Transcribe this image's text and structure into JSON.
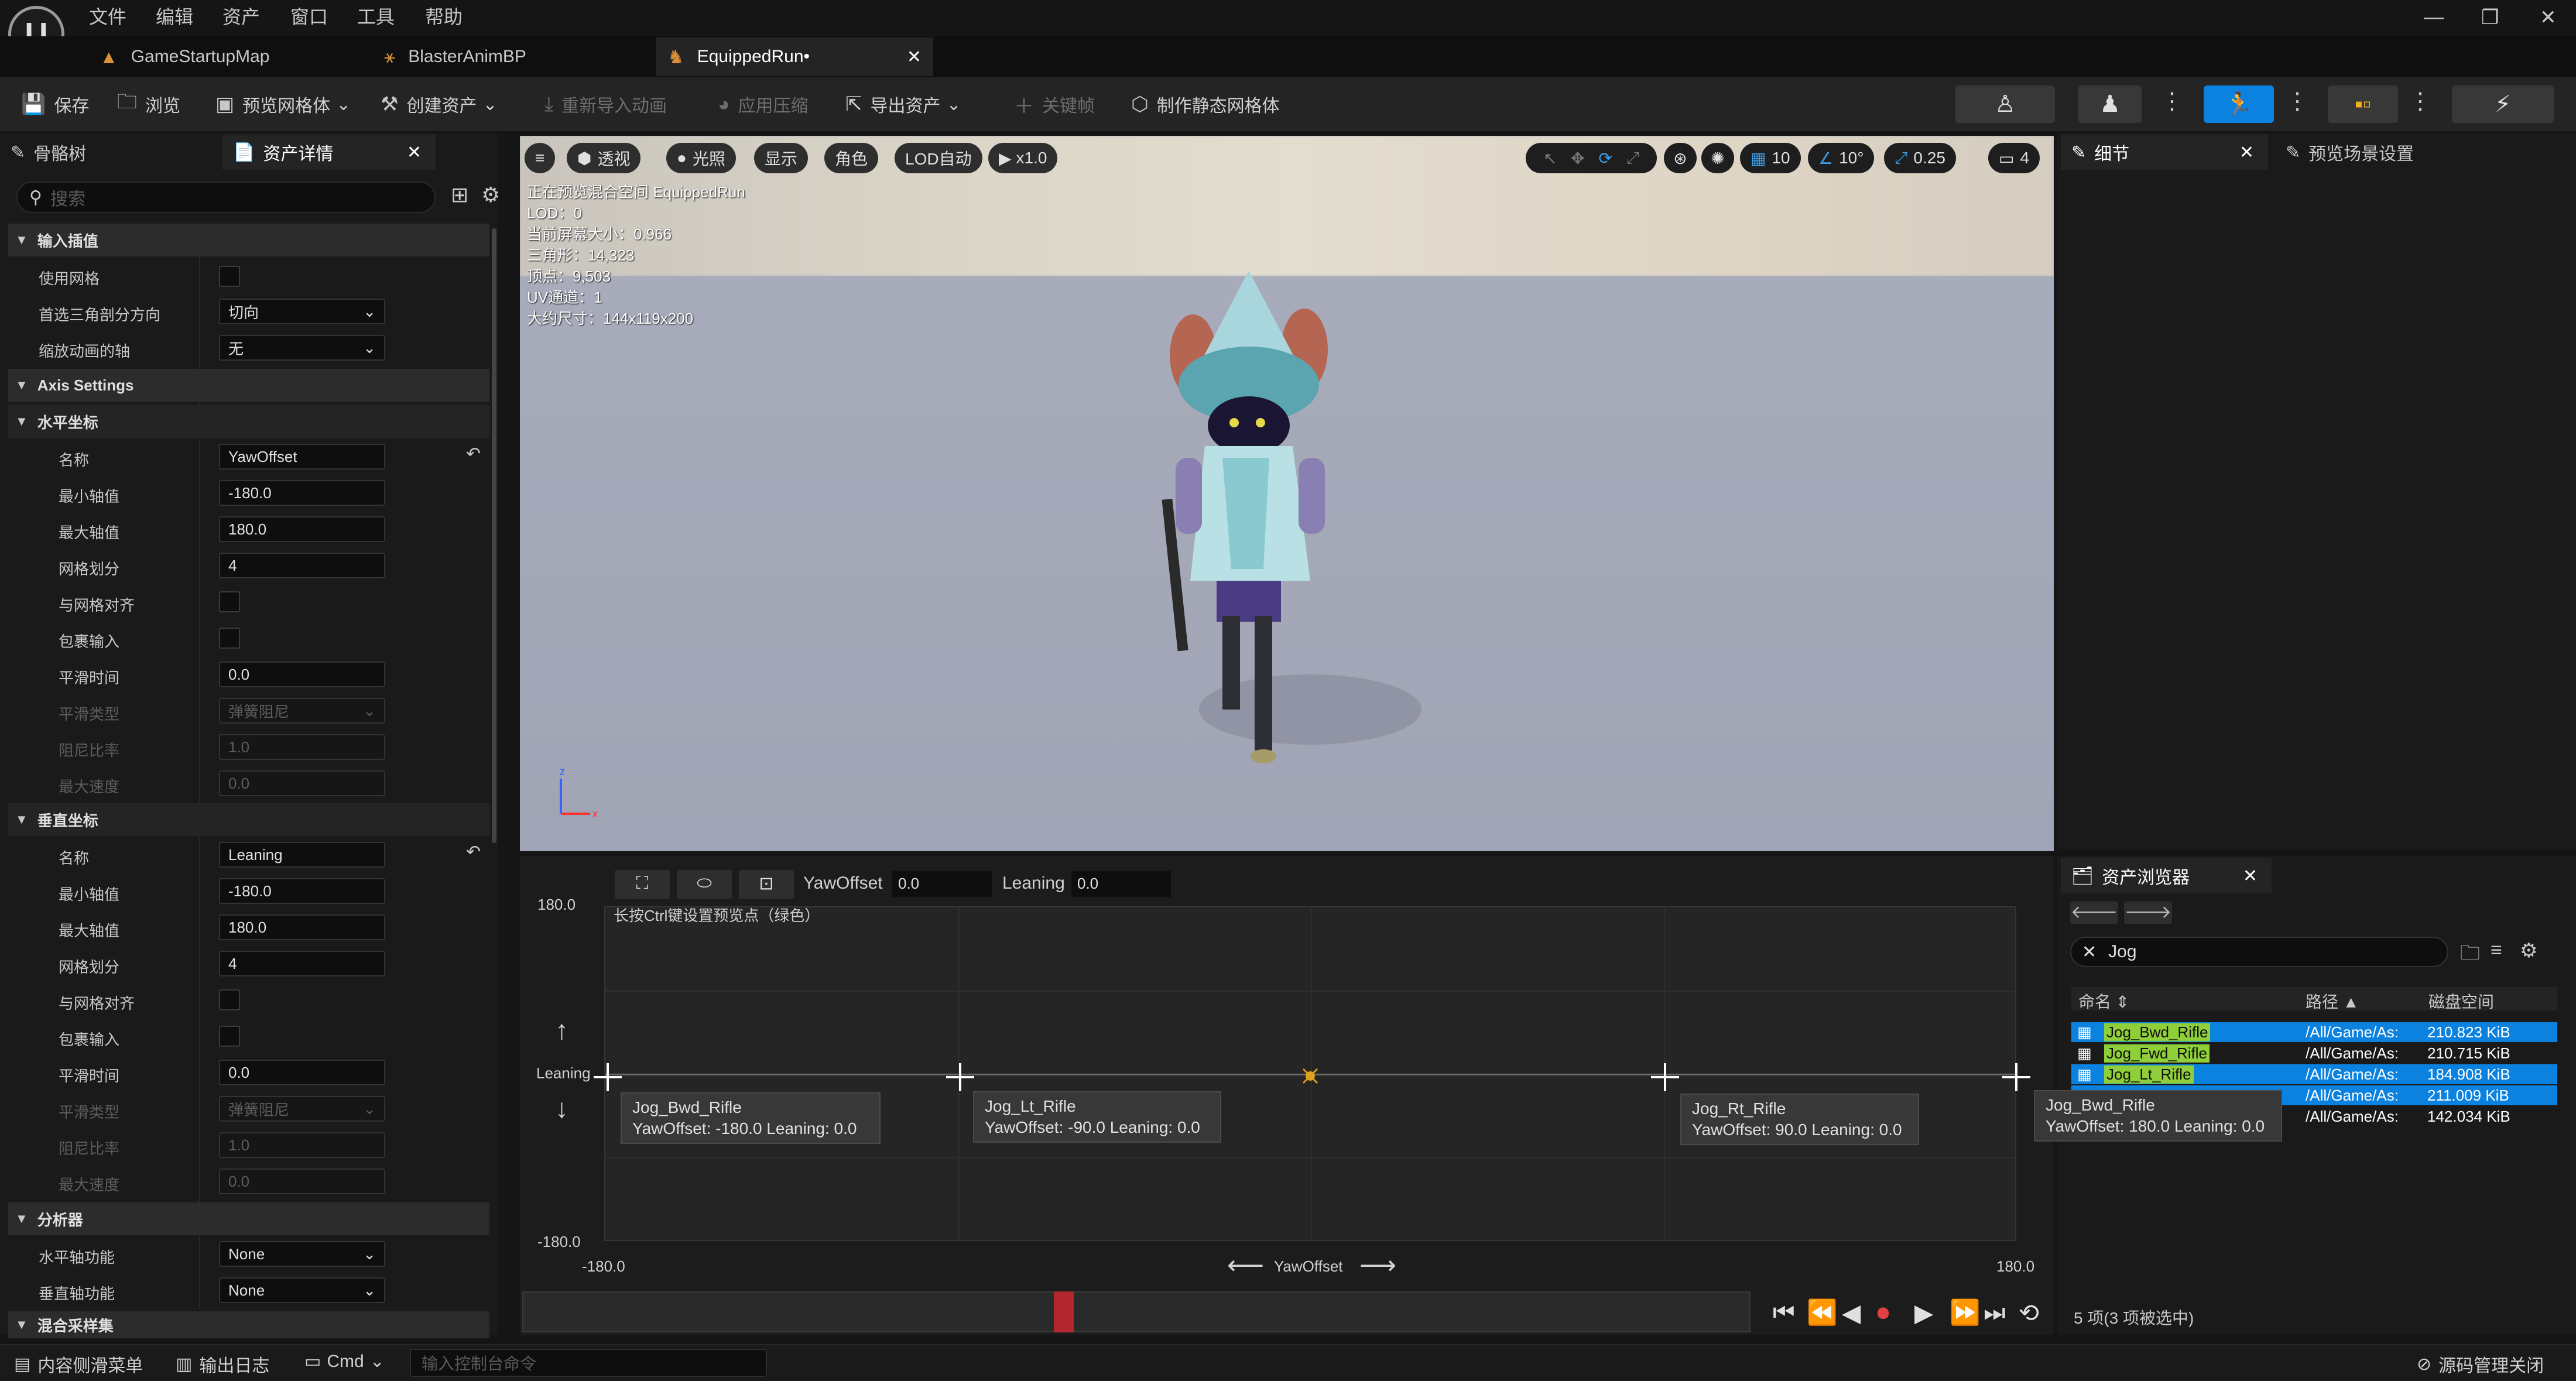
{
  "menu": [
    "文件",
    "编辑",
    "资产",
    "窗口",
    "工具",
    "帮助"
  ],
  "tabs": [
    {
      "label": "GameStartupMap",
      "icon": "level-icon"
    },
    {
      "label": "BlasterAnimBP",
      "icon": "anim-blueprint-icon"
    },
    {
      "label": "EquippedRun•",
      "icon": "blendspace-icon",
      "active": true
    }
  ],
  "toolbar": {
    "save": "保存",
    "browse": "浏览",
    "preview_mesh": "预览网格体",
    "create_asset": "创建资产",
    "reimport": "重新导入动画",
    "apply_compression": "应用压缩",
    "export_asset": "导出资产",
    "keyframe": "关键帧",
    "make_static_mesh": "制作静态网格体"
  },
  "left_panel": {
    "tab_skeleton": "骨骼树",
    "tab_asset_details": "资产详情",
    "search_placeholder": "搜索",
    "sections": {
      "input_interp": "输入插值",
      "axis_settings": "Axis Settings",
      "horizontal": "水平坐标",
      "vertical": "垂直坐标",
      "analysis": "分析器",
      "blend_samples": "混合采样集"
    },
    "labels": {
      "use_mesh": "使用网格",
      "preferred_tri_dir": "首选三角剖分方向",
      "scale_anim_axis": "缩放动画的轴",
      "name": "名称",
      "min": "最小轴值",
      "max": "最大轴值",
      "grid_divisions": "网格划分",
      "snap_grid": "与网格对齐",
      "wrap_input": "包裹输入",
      "smooth_time": "平滑时间",
      "smooth_type": "平滑类型",
      "damping_ratio": "阻尼比率",
      "max_speed": "最大速度",
      "h_func": "水平轴功能",
      "v_func": "垂直轴功能"
    },
    "values": {
      "preferred_tri_dir": "切向",
      "scale_anim_axis": "无",
      "h_name": "YawOffset",
      "h_min": "-180.0",
      "h_max": "180.0",
      "h_grid": "4",
      "h_smooth": "0.0",
      "h_smooth_type": "弹簧阻尼",
      "h_damping": "1.0",
      "h_maxspeed": "0.0",
      "v_name": "Leaning",
      "v_min": "-180.0",
      "v_max": "180.0",
      "v_grid": "4",
      "v_smooth": "0.0",
      "v_smooth_type": "弹簧阻尼",
      "v_damping": "1.0",
      "v_maxspeed": "0.0",
      "h_func": "None",
      "v_func": "None"
    }
  },
  "viewport": {
    "menu": "≡",
    "perspective": "透视",
    "lit": "光照",
    "show": "显示",
    "character": "角色",
    "lod": "LOD自动",
    "speed": "x1.0",
    "grid_snap": "10",
    "rot_snap": "10°",
    "scale_snap": "0.25",
    "cam_speed": "4",
    "stats": [
      "正在预览混合空间 EquippedRun",
      "LOD：0",
      "当前屏幕大小：0.966",
      "三角形：14,323",
      "顶点：9,503",
      "UV通道：1",
      "大约尺寸：144x119x200"
    ]
  },
  "right_panel": {
    "tab_details": "细节",
    "tab_preview_settings": "预览场景设置"
  },
  "asset_browser": {
    "title": "资产浏览器",
    "search_value": "Jog",
    "columns": [
      "命名",
      "路径",
      "磁盘空间"
    ],
    "rows": [
      {
        "name": "Jog_Bwd_Rifle",
        "path": "/All/Game/As:",
        "size": "210.823 KiB",
        "selected": true
      },
      {
        "name": "Jog_Fwd_Rifle",
        "path": "/All/Game/As:",
        "size": "210.715 KiB",
        "selected": false
      },
      {
        "name": "Jog_Lt_Rifle",
        "path": "/All/Game/As:",
        "size": "184.908 KiB",
        "selected": true
      },
      {
        "name": "",
        "path": "/All/Game/As:",
        "size": "211.009 KiB",
        "selected": true
      },
      {
        "name": "",
        "path": "/All/Game/As:",
        "size": "142.034 KiB",
        "selected": false
      }
    ],
    "footer": "5 项(3 项被选中)"
  },
  "blend_space": {
    "x_label": "YawOffset",
    "x_value": "0.0",
    "y_label": "Leaning",
    "y_value": "0.0",
    "hint": "长按Ctrl键设置预览点（绿色）",
    "y_max": "180.0",
    "y_min": "-180.0",
    "x_min": "-180.0",
    "x_max": "180.0",
    "y_axis_name": "Leaning",
    "x_axis_name": "YawOffset",
    "samples": [
      {
        "name": "Jog_Bwd_Rifle",
        "detail": "YawOffset: -180.0  Leaning: 0.0"
      },
      {
        "name": "Jog_Lt_Rifle",
        "detail": "YawOffset: -90.0  Leaning: 0.0"
      },
      {
        "name": "Jog_Rt_Rifle",
        "detail": "YawOffset: 90.0  Leaning: 0.0"
      },
      {
        "name": "Jog_Bwd_Rifle",
        "detail": "YawOffset: 180.0  Leaning: 0.0"
      }
    ]
  },
  "statusbar": {
    "content_drawer": "内容侧滑菜单",
    "output_log": "输出日志",
    "cmd": "Cmd",
    "console_placeholder": "输入控制台命令",
    "source_control": "源码管理关闭"
  }
}
